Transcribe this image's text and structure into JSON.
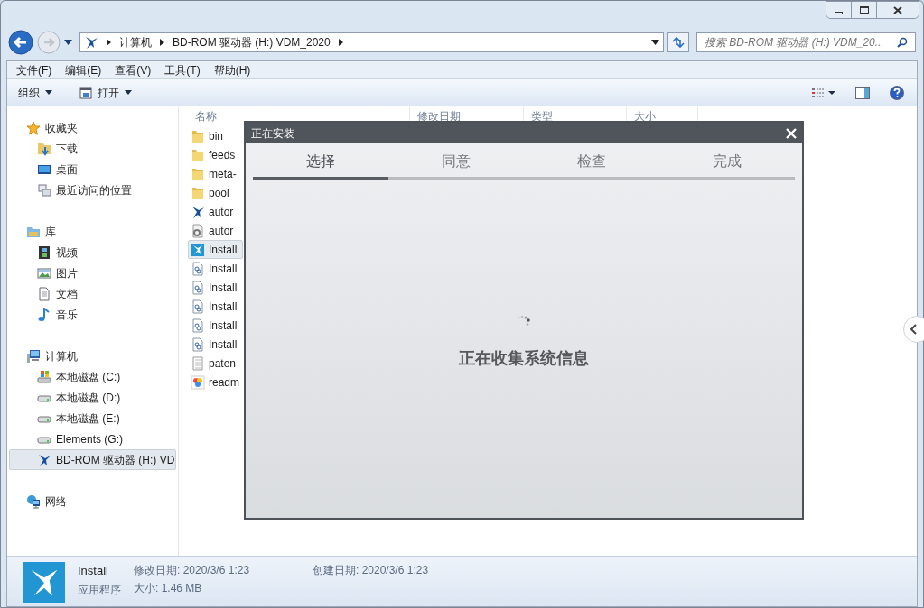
{
  "address_bar": {
    "crumbs": [
      "计算机",
      "BD-ROM 驱动器 (H:) VDM_2020"
    ]
  },
  "search": {
    "placeholder": "搜索 BD-ROM 驱动器 (H:) VDM_20..."
  },
  "menu": [
    "文件(F)",
    "编辑(E)",
    "查看(V)",
    "工具(T)",
    "帮助(H)"
  ],
  "toolbar": [
    {
      "label": "组织",
      "kind": "organize"
    },
    {
      "label": "打开",
      "kind": "open"
    }
  ],
  "nav": [
    {
      "label": "收藏夹",
      "kind": "star",
      "selected": false,
      "children": [
        {
          "label": "下载",
          "kind": "download",
          "selected": false
        },
        {
          "label": "桌面",
          "kind": "desktop",
          "selected": false
        },
        {
          "label": "最近访问的位置",
          "kind": "recent",
          "selected": false
        }
      ]
    },
    {
      "label": "库",
      "kind": "library",
      "selected": false,
      "children": [
        {
          "label": "视频",
          "kind": "video",
          "selected": false
        },
        {
          "label": "图片",
          "kind": "picture",
          "selected": false
        },
        {
          "label": "文档",
          "kind": "document",
          "selected": false
        },
        {
          "label": "音乐",
          "kind": "music",
          "selected": false
        }
      ]
    },
    {
      "label": "计算机",
      "kind": "computer",
      "selected": false,
      "children": [
        {
          "label": "本地磁盘 (C:)",
          "kind": "system-drive",
          "selected": false
        },
        {
          "label": "本地磁盘 (D:)",
          "kind": "drive",
          "selected": false
        },
        {
          "label": "本地磁盘 (E:)",
          "kind": "drive",
          "selected": false
        },
        {
          "label": "Elements (G:)",
          "kind": "drive",
          "selected": false
        },
        {
          "label": "BD-ROM 驱动器 (H:) VD",
          "kind": "optical",
          "selected": true
        }
      ]
    },
    {
      "label": "网络",
      "kind": "network",
      "selected": false
    }
  ],
  "columns": [
    "名称",
    "修改日期",
    "类型",
    "大小"
  ],
  "files": [
    {
      "name": "bin",
      "kind": "folder",
      "selected": false
    },
    {
      "name": "feeds",
      "kind": "folder",
      "selected": false
    },
    {
      "name": "meta-",
      "kind": "folder",
      "selected": false
    },
    {
      "name": "pool",
      "kind": "folder",
      "selected": false
    },
    {
      "name": "autor",
      "kind": "logo",
      "selected": false
    },
    {
      "name": "autor",
      "kind": "settings",
      "selected": false
    },
    {
      "name": "Install",
      "kind": "app",
      "selected": true
    },
    {
      "name": "Install",
      "kind": "package",
      "selected": false
    },
    {
      "name": "Install",
      "kind": "package",
      "selected": false
    },
    {
      "name": "Install",
      "kind": "package",
      "selected": false
    },
    {
      "name": "Install",
      "kind": "package",
      "selected": false
    },
    {
      "name": "Install",
      "kind": "package",
      "selected": false
    },
    {
      "name": "paten",
      "kind": "text",
      "selected": false
    },
    {
      "name": "readm",
      "kind": "color",
      "selected": false
    }
  ],
  "dialog": {
    "title": "正在安装",
    "steps": [
      {
        "label": "选择",
        "selected": true
      },
      {
        "label": "同意",
        "selected": false
      },
      {
        "label": "检查",
        "selected": false
      },
      {
        "label": "完成",
        "selected": false
      }
    ],
    "message": "正在收集系统信息"
  },
  "status_bar": {
    "name": "Install",
    "type": "应用程序",
    "modified": "修改日期: 2020/3/6 1:23",
    "created": "创建日期: 2020/3/6 1:23",
    "size": "大小: 1.46 MB"
  }
}
